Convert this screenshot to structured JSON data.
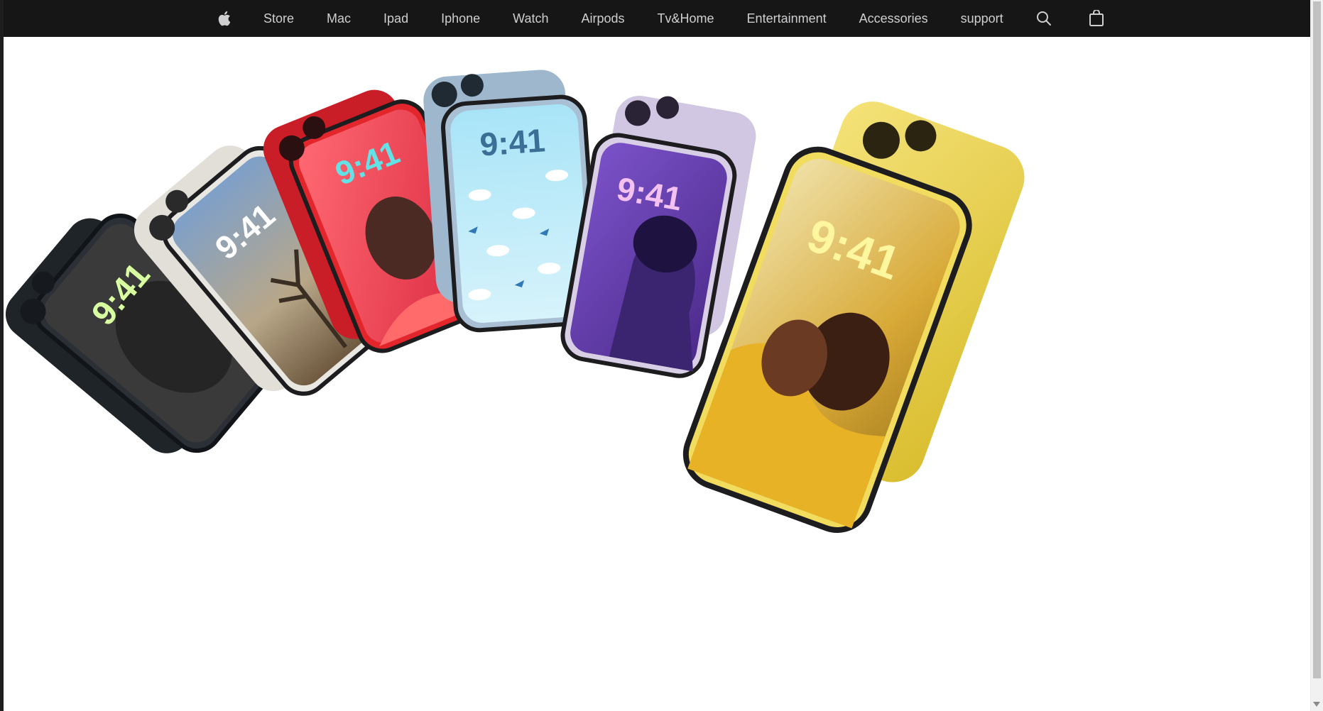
{
  "nav": {
    "items": [
      "Store",
      "Mac",
      "Ipad",
      "Iphone",
      "Watch",
      "Airpods",
      "Tv&Home",
      "Entertainment",
      "Accessories",
      "support"
    ],
    "icons": [
      "apple-logo-icon",
      "search-icon",
      "bag-icon"
    ]
  },
  "hero": {
    "phones": [
      {
        "color": "#2b3036",
        "screen": "#3a3a3a",
        "time": "9:41",
        "time_color": "#d8ffa0"
      },
      {
        "color": "#e9e7e1",
        "screen": "#8aa7c8",
        "time": "9:41",
        "time_color": "#ffffff"
      },
      {
        "color": "#e3262b",
        "screen": "#f04a55",
        "time": "9:41",
        "time_color": "#62e2e6"
      },
      {
        "color": "#a9bfd4",
        "screen": "#bfe7f6",
        "time": "9:41",
        "time_color": "#3b6f96"
      },
      {
        "color": "#d8cfe6",
        "screen": "#6a3fb5",
        "time": "9:41",
        "time_color": "#f3c2f0"
      },
      {
        "color": "#f1dc5e",
        "screen": "#efd98a",
        "time": "9:41",
        "time_color": "#fff6a0"
      }
    ]
  },
  "colors": {
    "navbar_bg": "#161617",
    "nav_text": "#cfcfd1"
  }
}
